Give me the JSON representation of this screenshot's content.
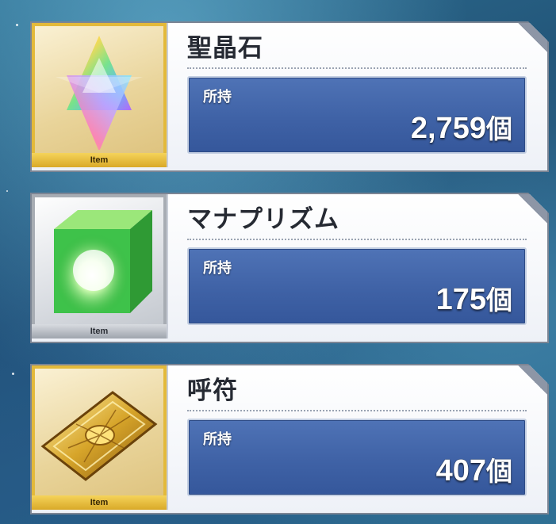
{
  "items": [
    {
      "name": "聖晶石",
      "owned_label": "所持",
      "count": "2,759",
      "unit": "個",
      "tag": "Item",
      "icon": "star-crystal-icon"
    },
    {
      "name": "マナプリズム",
      "owned_label": "所持",
      "count": "175",
      "unit": "個",
      "tag": "Item",
      "icon": "green-cube-icon"
    },
    {
      "name": "呼符",
      "owned_label": "所持",
      "count": "407",
      "unit": "個",
      "tag": "Item",
      "icon": "golden-ticket-icon"
    }
  ],
  "colors": {
    "panel_blue": "#3f62a6",
    "gold_frame": "#e3b93a",
    "silver_frame": "#a7acb3"
  }
}
